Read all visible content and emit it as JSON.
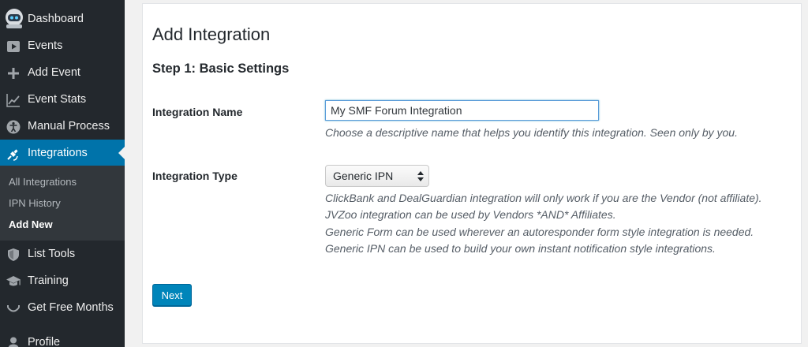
{
  "sidebar": {
    "menu": [
      {
        "label": "Dashboard",
        "icon": "robot-avatar-icon"
      },
      {
        "label": "Events",
        "icon": "play-icon"
      },
      {
        "label": "Add Event",
        "icon": "plus-icon"
      },
      {
        "label": "Event Stats",
        "icon": "chart-line-icon"
      },
      {
        "label": "Manual Process",
        "icon": "accessibility-icon"
      },
      {
        "label": "Integrations",
        "icon": "plug-icon",
        "active": true
      }
    ],
    "submenu": [
      {
        "label": "All Integrations"
      },
      {
        "label": "IPN History"
      },
      {
        "label": "Add New",
        "current": true
      }
    ],
    "menu_bottom": [
      {
        "label": "List Tools",
        "icon": "shield-icon"
      },
      {
        "label": "Training",
        "icon": "graduation-cap-icon"
      },
      {
        "label": "Get Free Months",
        "icon": "smile-icon"
      },
      {
        "label": "Profile",
        "icon": "user-icon"
      }
    ]
  },
  "main": {
    "title": "Add Integration",
    "step_title": "Step 1: Basic Settings",
    "name_field": {
      "label": "Integration Name",
      "value": "My SMF Forum Integration",
      "description": "Choose a descriptive name that helps you identify this integration. Seen only by you."
    },
    "type_field": {
      "label": "Integration Type",
      "selected": "Generic IPN",
      "descriptions": [
        "ClickBank and DealGuardian integration will only work if you are the Vendor (not affiliate).",
        "JVZoo integration can be used by Vendors *AND* Affiliates.",
        "Generic Form can be used wherever an autoresponder form style integration is needed.",
        "Generic IPN can be used to build your own instant notification style integrations."
      ]
    },
    "next_label": "Next"
  },
  "colors": {
    "sidebar_bg": "#23282d",
    "active_bg": "#0073aa",
    "button_bg": "#0085ba"
  }
}
